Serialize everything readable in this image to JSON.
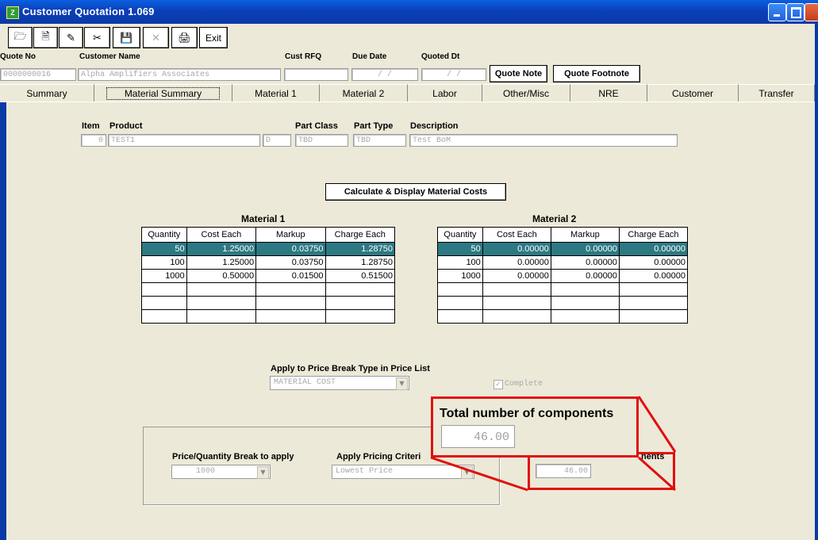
{
  "window": {
    "title": "Customer Quotation    1.069"
  },
  "toolbar": {
    "exit_label": "Exit",
    "exit_hotkey": "x"
  },
  "header": {
    "quote_no_label": "Quote No",
    "quote_no_value": "0000000016",
    "customer_name_label": "Customer Name",
    "customer_name_value": "Alpha Amplifiers Associates",
    "cust_rfq_label": "Cust RFQ",
    "cust_rfq_value": "",
    "due_date_label": "Due Date",
    "due_date_value": "/  /",
    "quoted_dt_label": "Quoted Dt",
    "quoted_dt_value": "/  /",
    "quote_note_btn": "Quote Note",
    "quote_footnote_btn": "Quote Footnote"
  },
  "tabs": [
    "Summary",
    "Material Summary",
    "Material 1",
    "Material 2",
    "Labor",
    "Other/Misc",
    "NRE",
    "Customer",
    "Transfer"
  ],
  "active_tab": "Material Summary",
  "item": {
    "item_label": "Item",
    "item_value": "0",
    "product_label": "Product",
    "product_value": "TEST1",
    "rev_value": "D",
    "part_class_label": "Part Class",
    "part_class_value": "TBD",
    "part_type_label": "Part Type",
    "part_type_value": "TBD",
    "description_label": "Description",
    "description_value": "Test BoM"
  },
  "calc_button": "Calculate & Display Material Costs",
  "material1": {
    "title": "Material 1",
    "columns": [
      "Quantity",
      "Cost Each",
      "Markup",
      "Charge Each"
    ],
    "rows": [
      [
        "50",
        "1.25000",
        "0.03750",
        "1.28750"
      ],
      [
        "100",
        "1.25000",
        "0.03750",
        "1.28750"
      ],
      [
        "1000",
        "0.50000",
        "0.01500",
        "0.51500"
      ],
      [
        "",
        "",
        "",
        ""
      ],
      [
        "",
        "",
        "",
        ""
      ],
      [
        "",
        "",
        "",
        ""
      ]
    ]
  },
  "material2": {
    "title": "Material 2",
    "columns": [
      "Quantity",
      "Cost Each",
      "Markup",
      "Charge Each"
    ],
    "rows": [
      [
        "50",
        "0.00000",
        "0.00000",
        "0.00000"
      ],
      [
        "100",
        "0.00000",
        "0.00000",
        "0.00000"
      ],
      [
        "1000",
        "0.00000",
        "0.00000",
        "0.00000"
      ],
      [
        "",
        "",
        "",
        ""
      ],
      [
        "",
        "",
        "",
        ""
      ],
      [
        "",
        "",
        "",
        ""
      ]
    ]
  },
  "apply": {
    "label": "Apply to Price Break Type in Price List",
    "value": "MATERIAL COST",
    "complete_label": "Complete",
    "complete_checked": true
  },
  "lower": {
    "price_break_label": "Price/Quantity Break to apply",
    "price_break_value": "1000",
    "criteria_label": "Apply Pricing Criteri",
    "criteria_value": "Lowest Price",
    "components_label_partial": "nents",
    "components_value": "46.00"
  },
  "callout": {
    "title": "Total number of components",
    "value": "46.00"
  },
  "colors": {
    "selected_row": "#2d7983",
    "callout": "#e01010",
    "titlebar": "#0a3fb8"
  }
}
